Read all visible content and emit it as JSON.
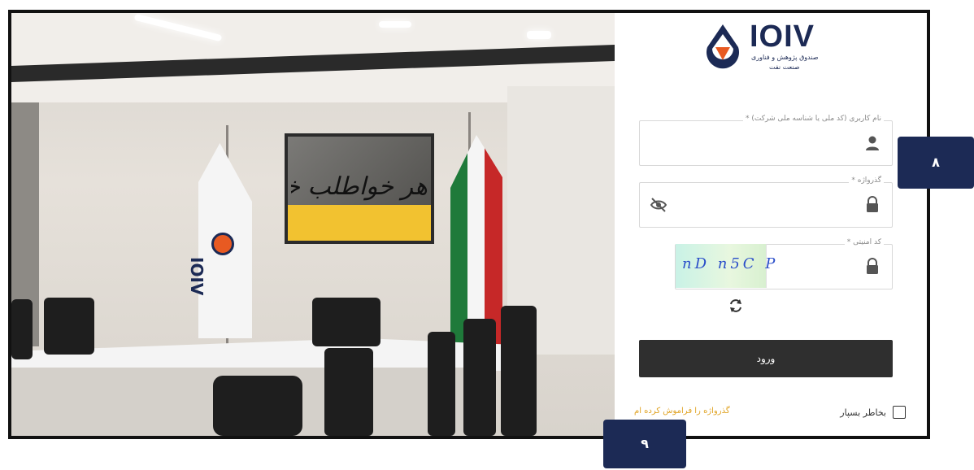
{
  "logo": {
    "title": "IOIV",
    "subtitle_line1": "صندوق پژوهش و فناوری",
    "subtitle_line2": "صنعت نفت"
  },
  "painting": {
    "text": "هر خواطلب خواهی آنجا طلب کرد"
  },
  "photo_flag": {
    "text": "IOIV"
  },
  "form": {
    "username": {
      "label": "نام کاربری (کد ملی یا شناسه ملی شرکت) *",
      "value": "",
      "icon": "user-icon"
    },
    "password": {
      "label": "گذرواژه *",
      "value": "",
      "icon": "lock-icon",
      "toggle_icon": "eye-off-icon"
    },
    "captcha": {
      "label": "کد امنیتی *",
      "value": "",
      "image_text": "nD n5C P",
      "icon": "lock-icon",
      "refresh_icon": "refresh-icon"
    },
    "submit_label": "ورود",
    "remember_label": "بخاطر بسپار",
    "forgot_label": "گذرواژه را فراموش کرده ام"
  },
  "badges": {
    "fields_badge": "۸",
    "links_badge": "۹"
  },
  "colors": {
    "brand_navy": "#1c2a55",
    "brand_orange": "#e85a22",
    "button_dark": "#2f2f2f",
    "link_gold": "#e0a323"
  }
}
